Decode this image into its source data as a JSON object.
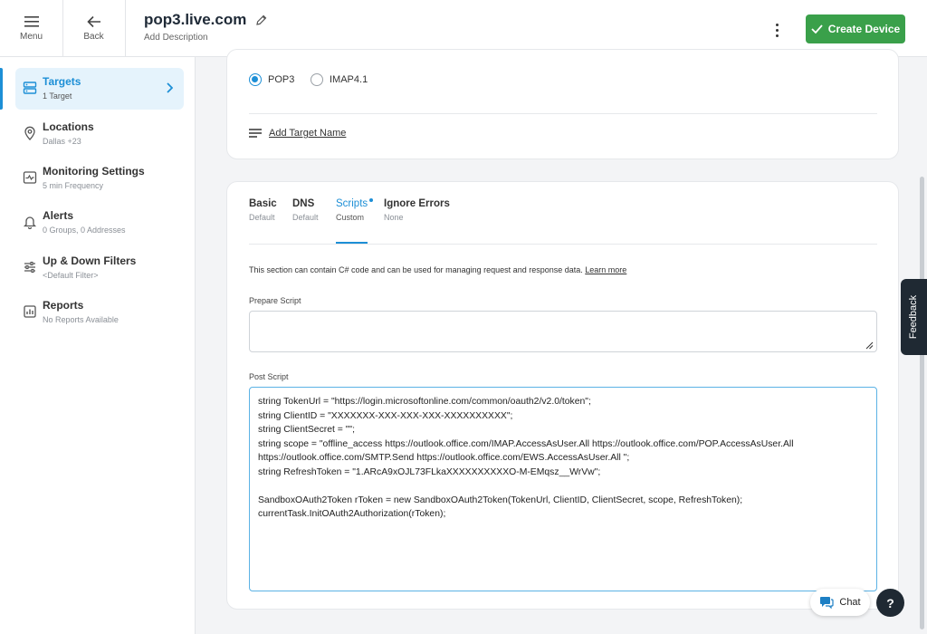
{
  "header": {
    "menu_label": "Menu",
    "back_label": "Back",
    "title": "pop3.live.com",
    "add_description": "Add Description",
    "create_button": "Create Device",
    "accent_color": "#3aa04a"
  },
  "sidebar": {
    "items": [
      {
        "label": "Targets",
        "sub": "1 Target",
        "icon": "server-icon",
        "active": true
      },
      {
        "label": "Locations",
        "sub": "Dallas +23",
        "icon": "location-pin-icon"
      },
      {
        "label": "Monitoring Settings",
        "sub": "5 min Frequency",
        "icon": "monitor-settings-icon"
      },
      {
        "label": "Alerts",
        "sub": "0 Groups, 0 Addresses",
        "icon": "bell-icon"
      },
      {
        "label": "Up & Down Filters",
        "sub": "<Default Filter>",
        "icon": "sliders-icon"
      },
      {
        "label": "Reports",
        "sub": "No Reports Available",
        "icon": "report-icon"
      }
    ],
    "active_color": "#1d8fd6"
  },
  "target": {
    "protocol_options": [
      "POP3",
      "IMAP4.1"
    ],
    "selected_protocol": "POP3",
    "add_target_name": "Add Target Name"
  },
  "tabs": [
    {
      "label": "Basic",
      "sub": "Default"
    },
    {
      "label": "DNS",
      "sub": "Default"
    },
    {
      "label": "Scripts",
      "sub": "Custom",
      "active": true
    },
    {
      "label": "Ignore Errors",
      "sub": "None"
    }
  ],
  "scripts": {
    "description": "This section can contain C# code and can be used for managing request and response data.",
    "learn_more": "Learn more",
    "prepare_label": "Prepare Script",
    "prepare_value": "",
    "post_label": "Post Script",
    "post_value": "string TokenUrl = \"https://login.microsoftonline.com/common/oauth2/v2.0/token\";\nstring ClientID = \"XXXXXXX-XXX-XXX-XXX-XXXXXXXXXX\";\nstring ClientSecret = \"\";\nstring scope = \"offline_access https://outlook.office.com/IMAP.AccessAsUser.All https://outlook.office.com/POP.AccessAsUser.All\nhttps://outlook.office.com/SMTP.Send https://outlook.office.com/EWS.AccessAsUser.All \";\nstring RefreshToken = \"1.ARcA9xOJL73FLkaXXXXXXXXXXO-M-EMqsz__WrVw\";\n\nSandboxOAuth2Token rToken = new SandboxOAuth2Token(TokenUrl, ClientID, ClientSecret, scope, RefreshToken);\ncurrentTask.InitOAuth2Authorization(rToken);"
  },
  "feedback_label": "Feedback",
  "chat_label": "Chat",
  "help_label": "?"
}
